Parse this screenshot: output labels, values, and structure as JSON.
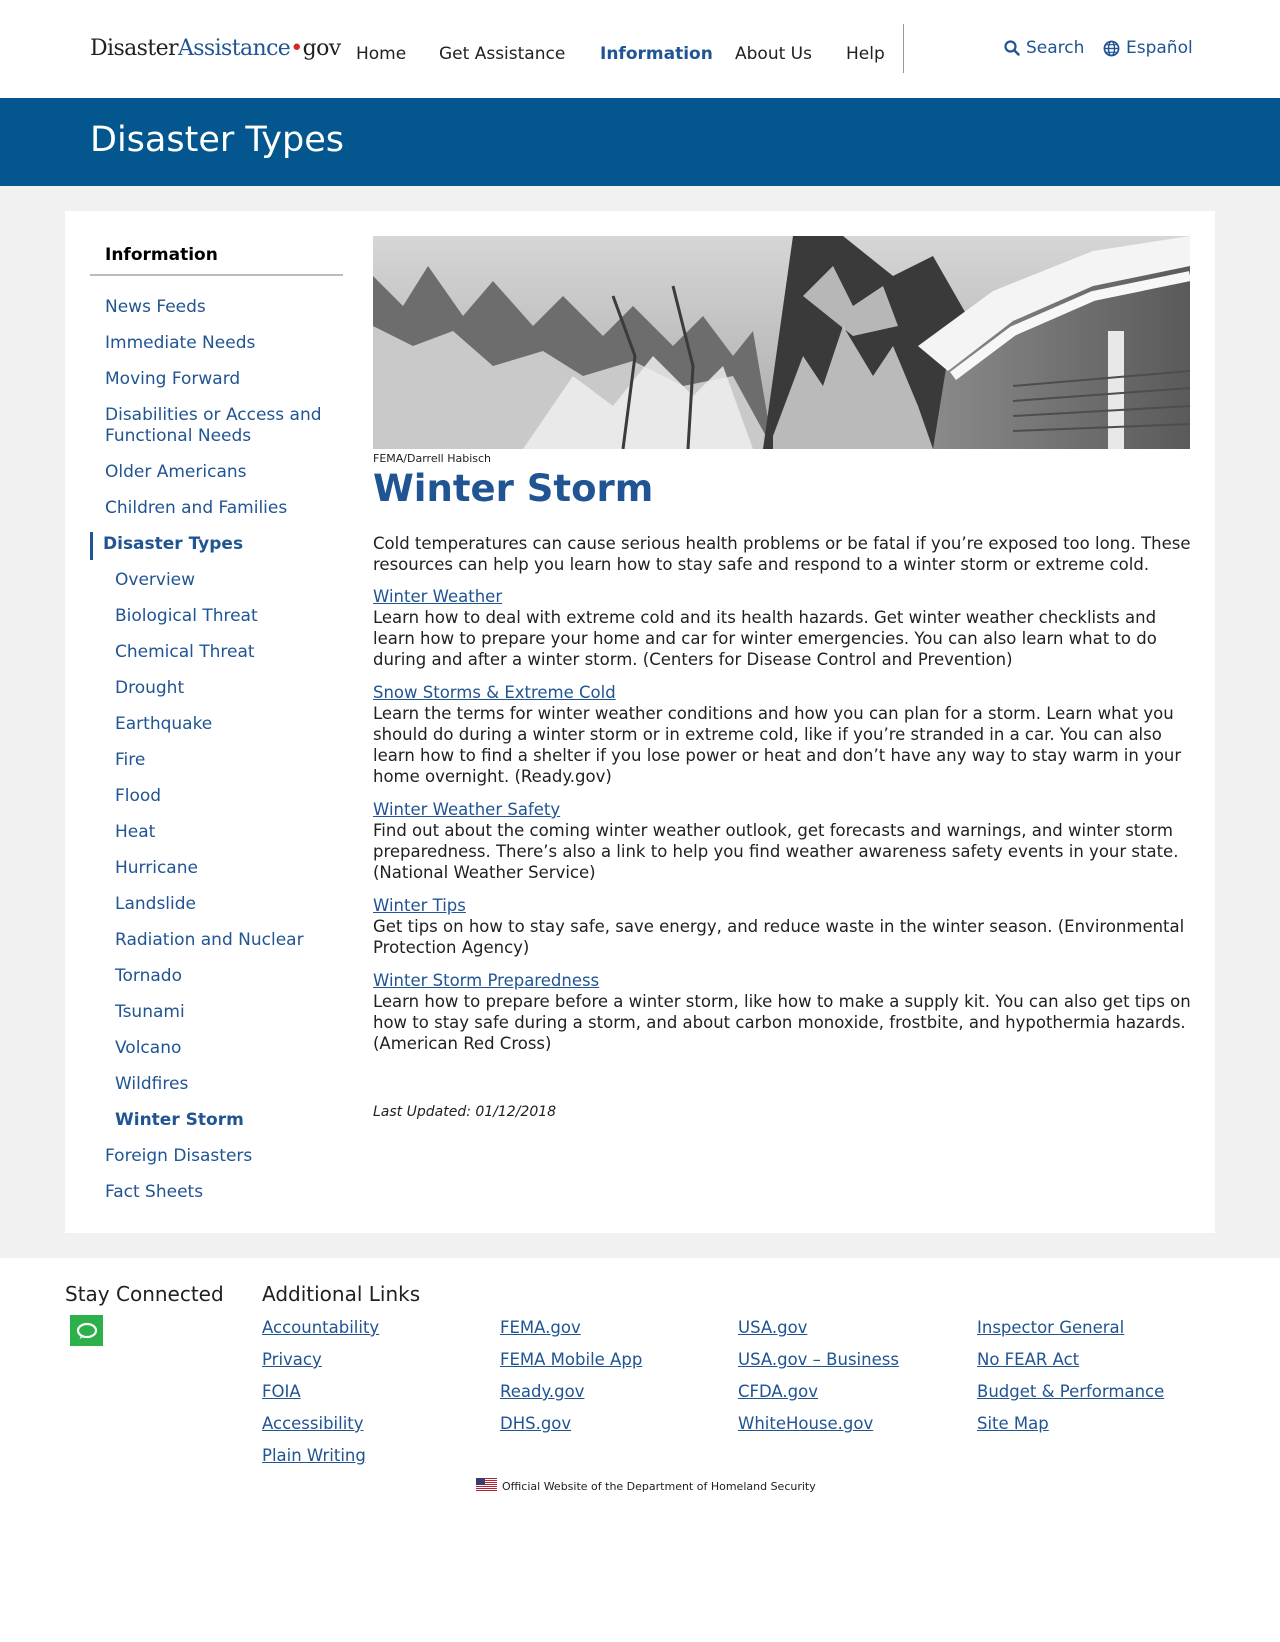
{
  "header": {
    "logo": {
      "part1": "Disaster",
      "part2": "Assistance",
      "dot": "•",
      "part3": "gov"
    },
    "nav": [
      "Home",
      "Get Assistance",
      "Information",
      "About Us",
      "Help"
    ],
    "active_nav": "Information",
    "search_label": "Search",
    "language_label": "Español"
  },
  "banner": {
    "title": "Disaster Types"
  },
  "sidebar": {
    "title": "Information",
    "items": [
      "News Feeds",
      "Immediate Needs",
      "Moving Forward",
      "Disabilities or Access and Functional Needs",
      "Older Americans",
      "Children and Families",
      "Disaster Types",
      "Foreign Disasters",
      "Fact Sheets"
    ],
    "subitems": [
      "Overview",
      "Biological Threat",
      "Chemical Threat",
      "Drought",
      "Earthquake",
      "Fire",
      "Flood",
      "Heat",
      "Hurricane",
      "Landslide",
      "Radiation and Nuclear",
      "Tornado",
      "Tsunami",
      "Volcano",
      "Wildfires",
      "Winter Storm"
    ]
  },
  "main": {
    "image_credit": "FEMA/Darrell Habisch",
    "title": "Winter Storm",
    "intro": "Cold temperatures can cause serious health problems or be fatal if you’re exposed too long. These resources can help you learn how to stay safe and respond to a winter storm or extreme cold.",
    "resources": [
      {
        "link": "Winter Weather",
        "text": "Learn how to deal with extreme cold and its health hazards. Get winter weather checklists and learn how to prepare your home and car for winter emergencies. You can also learn what to do during and after a winter storm. (Centers for Disease Control and Prevention)"
      },
      {
        "link": "Snow Storms & Extreme Cold",
        "text": "Learn the terms for winter weather conditions and how you can plan for a storm. Learn what you should do during a winter storm or in extreme cold, like if you’re stranded in a car. You can also learn how to find a shelter if you lose power or heat and don’t have any way to stay warm in your home overnight. (Ready.gov)"
      },
      {
        "link": "Winter Weather Safety",
        "text": "Find out about the coming winter weather outlook, get forecasts and warnings, and winter storm preparedness. There’s also a link to help you find weather awareness safety events in your state. (National Weather Service)"
      },
      {
        "link": "Winter Tips",
        "text": "Get tips on how to stay safe, save energy, and reduce waste in the winter season. (Environmental Protection Agency)"
      },
      {
        "link": "Winter Storm Preparedness",
        "text": "Learn how to prepare before a winter storm, like how to make a supply kit. You can also get tips on how to stay safe during a storm, and about carbon monoxide, frostbite, and hypothermia hazards. (American Red Cross)"
      }
    ],
    "last_updated": "Last Updated: 01/12/2018"
  },
  "footer": {
    "stay_connected": "Stay Connected",
    "additional_links": "Additional Links",
    "columns": [
      [
        "Accountability",
        "Privacy",
        "FOIA",
        "Accessibility",
        "Plain Writing"
      ],
      [
        "FEMA.gov",
        "FEMA Mobile App",
        "Ready.gov",
        "DHS.gov"
      ],
      [
        "USA.gov",
        "USA.gov – Business",
        "CFDA.gov",
        "WhiteHouse.gov"
      ],
      [
        "Inspector General",
        "No FEAR Act",
        "Budget & Performance",
        "Site Map"
      ]
    ],
    "official": "Official Website of the Department of Homeland Security"
  },
  "colors": {
    "brand_blue": "#205493",
    "banner_blue": "#04568f",
    "chat_green": "#2cb04a",
    "logo_dot_red": "#d52b1e"
  }
}
